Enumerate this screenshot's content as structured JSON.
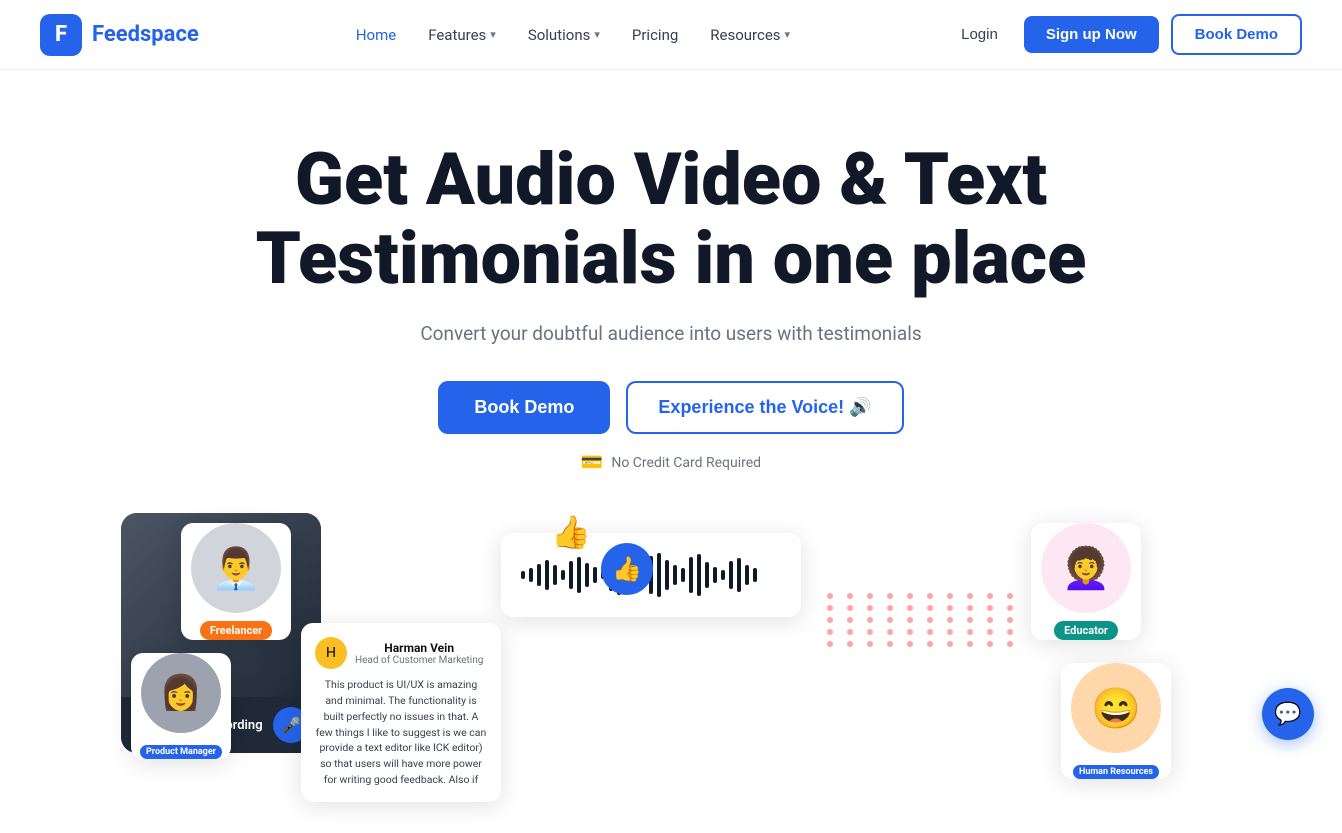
{
  "logo": {
    "icon": "F",
    "text_feed": "Feed",
    "text_space": "space"
  },
  "nav": {
    "links": [
      {
        "label": "Home",
        "active": true,
        "has_dropdown": false
      },
      {
        "label": "Features",
        "active": false,
        "has_dropdown": true
      },
      {
        "label": "Solutions",
        "active": false,
        "has_dropdown": true
      },
      {
        "label": "Pricing",
        "active": false,
        "has_dropdown": false
      },
      {
        "label": "Resources",
        "active": false,
        "has_dropdown": true
      }
    ],
    "login_label": "Login",
    "signup_label": "Sign up Now",
    "book_demo_label": "Book Demo"
  },
  "hero": {
    "heading": "Get Audio Video & Text Testimonials in one place",
    "subtext": "Convert your doubtful audience into users with testimonials",
    "btn_primary": "Book Demo",
    "btn_secondary": "Experience the Voice! 🔊",
    "no_card_text": "No Credit Card Required"
  },
  "floating": {
    "freelancer_label": "Freelancer",
    "pm_label": "Product Manager",
    "educator_label": "Educator",
    "hr_label": "Human Resources",
    "recording_label": "Start Recording",
    "testimonial_name": "Harman Vein",
    "testimonial_role": "Head of Customer Marketing",
    "testimonial_text": "This product is UI/UX is amazing and minimal. The functionality is built perfectly no issues in that. A few things I like to suggest is we can provide a text editor like ICK editor) so that users will have more power for writing good feedback. Also if"
  },
  "chat": {
    "icon": "💬"
  }
}
